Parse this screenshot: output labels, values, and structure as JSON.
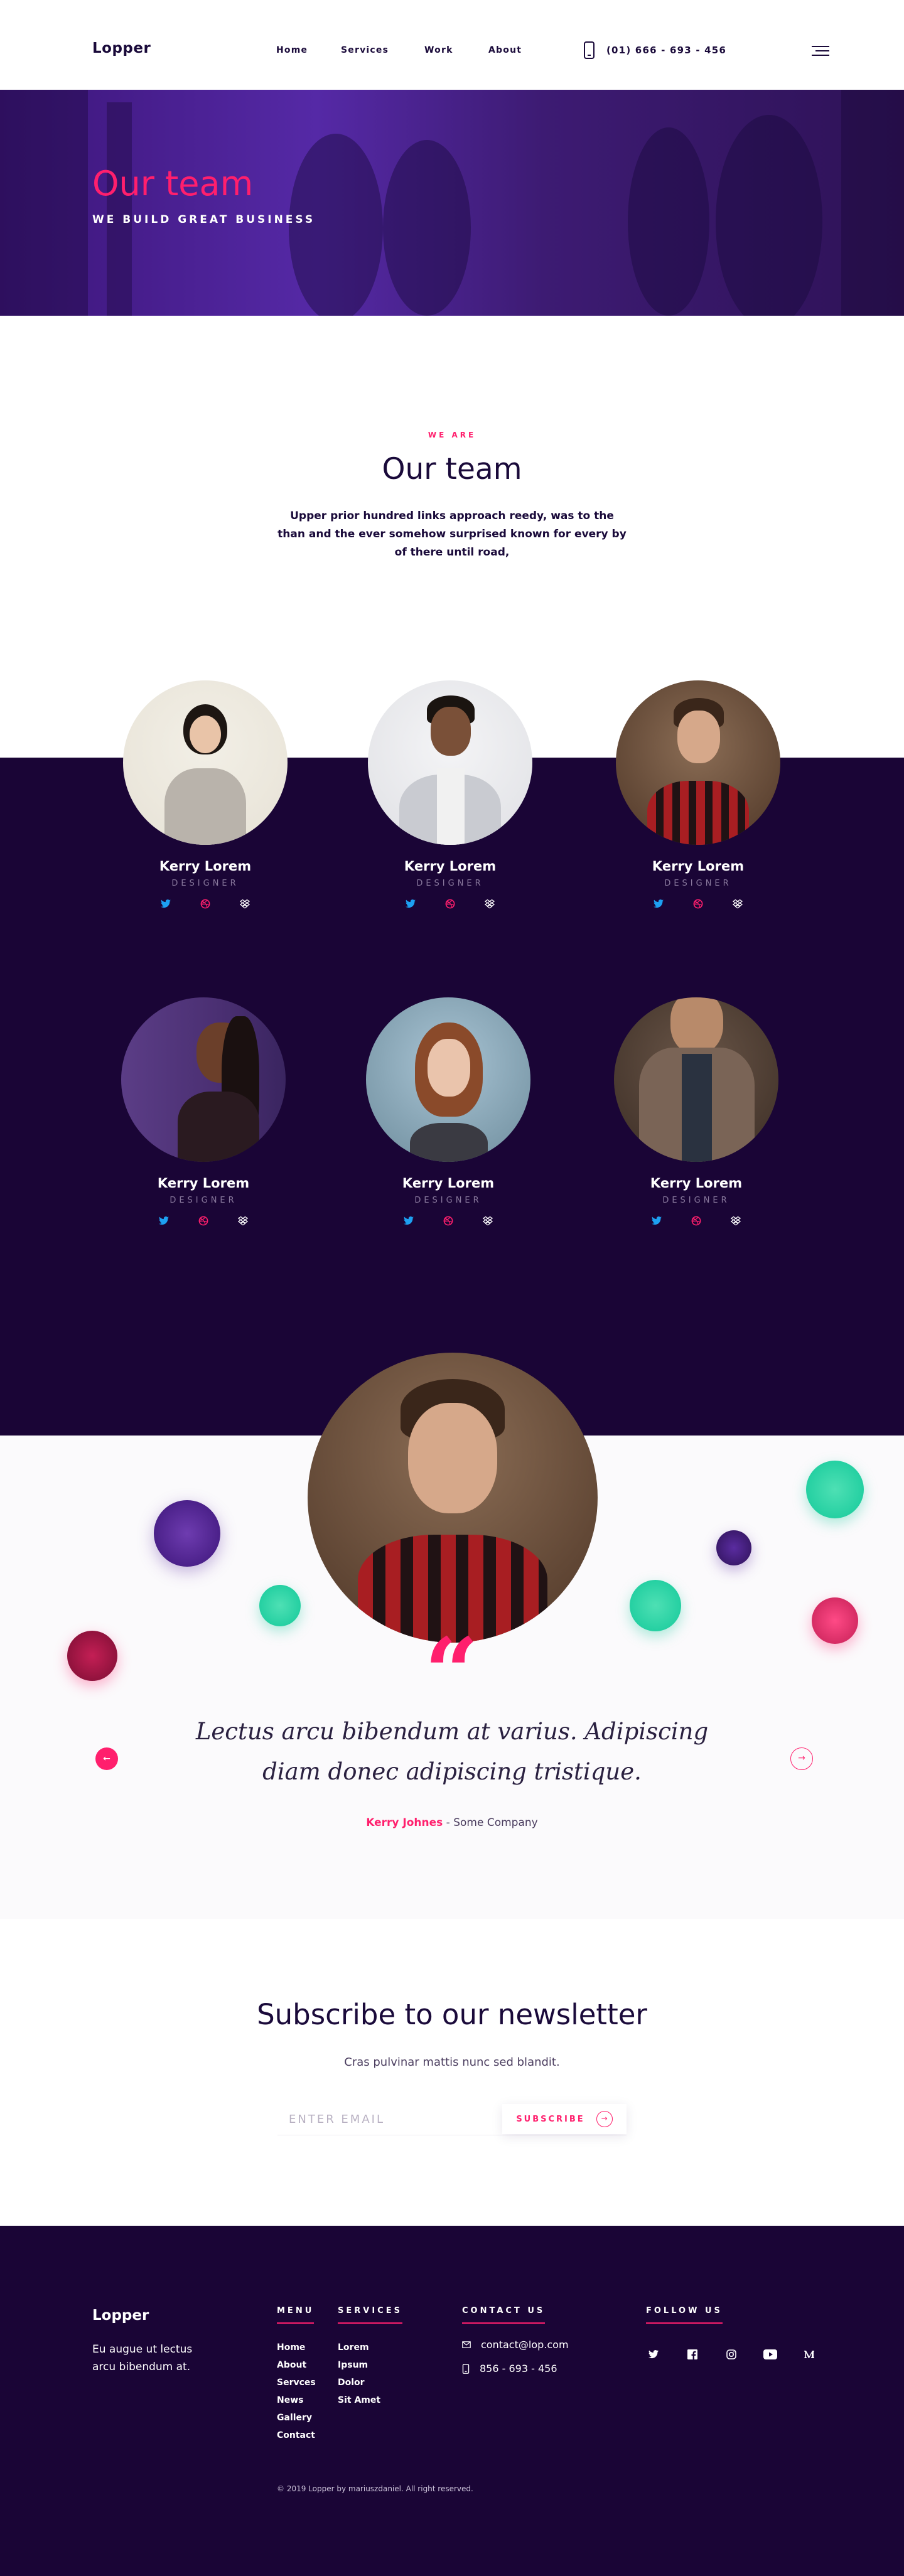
{
  "header": {
    "logo": "Lopper",
    "nav": [
      "Home",
      "Services",
      "Work",
      "About"
    ],
    "phone": "(01) 666 - 693 - 456"
  },
  "hero": {
    "title": "Our team",
    "subtitle": "WE BUILD GREAT BUSINESS"
  },
  "intro": {
    "eyebrow": "WE ARE",
    "title": "Our team",
    "text": "Upper prior hundred links approach reedy, was to the than and the ever somehow surprised known for every by of there until road,"
  },
  "team": [
    {
      "name": "Kerry Lorem",
      "role": "DESIGNER"
    },
    {
      "name": "Kerry Lorem",
      "role": "DESIGNER"
    },
    {
      "name": "Kerry Lorem",
      "role": "DESIGNER"
    },
    {
      "name": "Kerry Lorem",
      "role": "DESIGNER"
    },
    {
      "name": "Kerry Lorem",
      "role": "DESIGNER"
    },
    {
      "name": "Kerry Lorem",
      "role": "DESIGNER"
    }
  ],
  "testimonial": {
    "quote": "Lectus arcu bibendum at varius. Adipiscing diam donec adipiscing tristique.",
    "name": "Kerry Johnes",
    "separator": " - ",
    "company": "Some Company"
  },
  "newsletter": {
    "title": "Subscribe to our newsletter",
    "text": "Cras pulvinar mattis nunc sed blandit.",
    "placeholder": "ENTER EMAIL",
    "button": "SUBSCRIBE"
  },
  "footer": {
    "logo": "Lopper",
    "desc": "Eu augue ut lectus arcu bibendum at.",
    "menu_title": "MENU",
    "menu": [
      "Home",
      "About",
      "Servces",
      "News",
      "Gallery",
      "Contact"
    ],
    "services_title": "SERVICES",
    "services": [
      "Lorem",
      "Ipsum",
      "Dolor",
      "Sit Amet"
    ],
    "contact_title": "CONTACT US",
    "email": "contact@lop.com",
    "phone": "856 - 693 - 456",
    "follow_title": "FOLLOW US",
    "copyright": "© 2019 Lopper by mariuszdaniel. All right reserved."
  },
  "colors": {
    "accent": "#ff1f6d",
    "dark": "#1a0536",
    "twitter": "#1da1f2",
    "teal": "#13c99a"
  }
}
